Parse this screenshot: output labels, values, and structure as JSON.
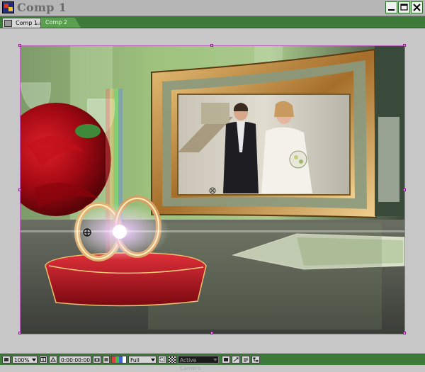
{
  "window": {
    "title": "Comp 1",
    "minimize_icon": "minimize-icon",
    "maximize_icon": "maximize-icon",
    "close_icon": "close-icon"
  },
  "tabs": [
    {
      "label": "Comp 1",
      "active": true
    },
    {
      "label": "Comp 2",
      "active": false
    }
  ],
  "viewer": {
    "content": "wedding-composition-preview"
  },
  "statusbar": {
    "zoom": "100%",
    "timecode": "0:00:00:00",
    "resolution": "Full",
    "camera": "Active Camera"
  },
  "colors": {
    "panel_green": "#3e7a3a",
    "viewer_bg": "#c7c7c7",
    "comp_border": "#c060c0"
  }
}
